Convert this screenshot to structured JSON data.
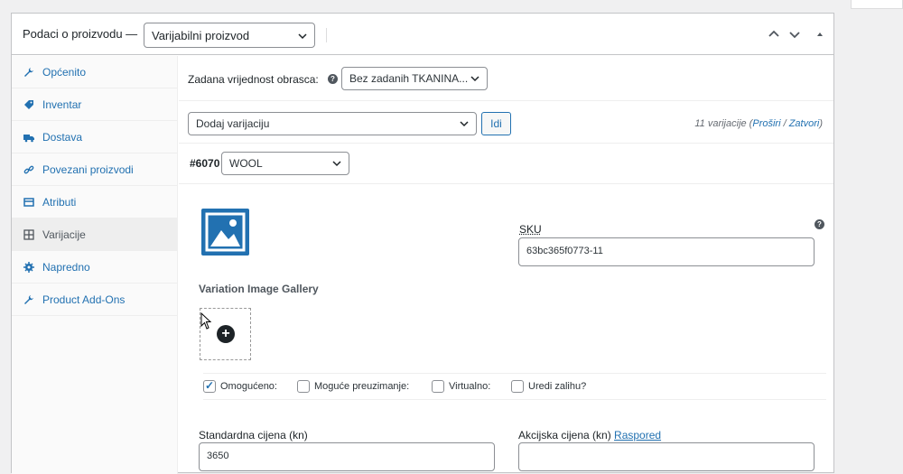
{
  "header": {
    "title": "Podaci o proizvodu —",
    "product_type": "Varijabilni proizvod"
  },
  "sidebar": {
    "items": [
      {
        "label": "Općenito",
        "icon": "wrench-icon"
      },
      {
        "label": "Inventar",
        "icon": "tag-icon"
      },
      {
        "label": "Dostava",
        "icon": "truck-icon"
      },
      {
        "label": "Povezani proizvodi",
        "icon": "link-icon"
      },
      {
        "label": "Atributi",
        "icon": "table-icon"
      },
      {
        "label": "Varijacije",
        "icon": "grid-icon"
      },
      {
        "label": "Napredno",
        "icon": "gear-icon"
      },
      {
        "label": "Product Add-Ons",
        "icon": "wrench-icon"
      }
    ],
    "active_index": 5
  },
  "defaults": {
    "label": "Zadana vrijednost obrasca:",
    "value": "Bez zadanih TKANINA..."
  },
  "variations": {
    "action_select": "Dodaj varijaciju",
    "go_button": "Idi",
    "count_text": "11 varijacije (",
    "expand": "Proširi",
    "separator": " / ",
    "collapse": "Zatvori",
    "count_close": ")"
  },
  "variation": {
    "id": "#6070",
    "attribute": "WOOL",
    "sku_label": "SKU",
    "sku_value": "63bc365f0773-11",
    "gallery_title": "Variation Image Gallery",
    "checkboxes": [
      {
        "label": "Omogućeno:",
        "checked": true
      },
      {
        "label": "Moguće preuzimanje:",
        "checked": false
      },
      {
        "label": "Virtualno:",
        "checked": false
      },
      {
        "label": "Uredi zalihu?",
        "checked": false
      }
    ],
    "regular_price_label": "Standardna cijena (kn)",
    "regular_price": "3650",
    "sale_price_label": "Akcijska cijena (kn) ",
    "schedule_link": "Raspored",
    "sale_price": ""
  },
  "colors": {
    "accent": "#2271b1",
    "text": "#1d2327"
  }
}
